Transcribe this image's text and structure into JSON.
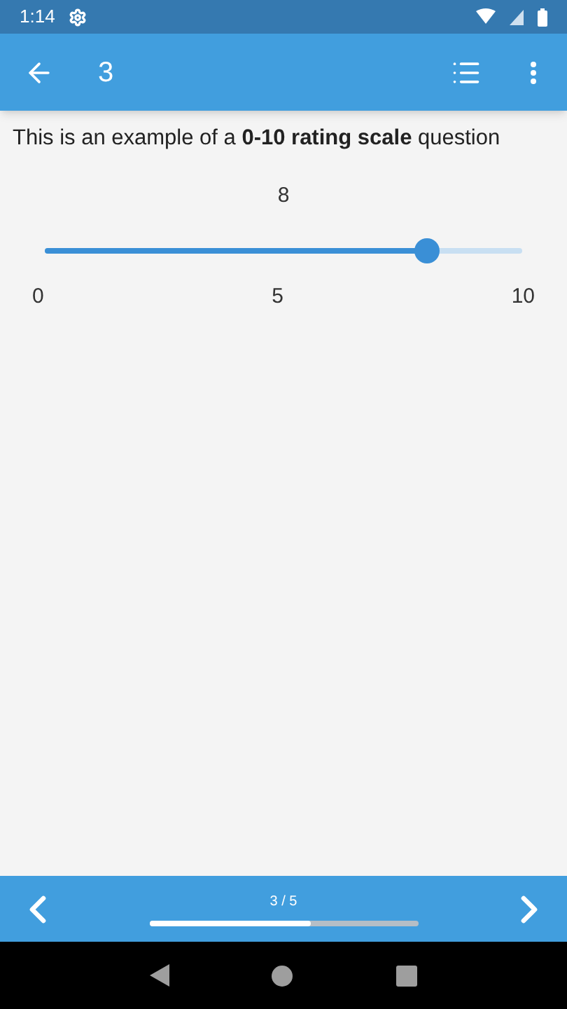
{
  "status_bar": {
    "time": "1:14"
  },
  "app_bar": {
    "title": "3"
  },
  "question": {
    "text": "This is an example of a **0-10 rating scale** question",
    "value": "8",
    "slider": {
      "level": 0.8
    },
    "labels": [
      "0",
      "5",
      "10"
    ]
  },
  "footer": {
    "counter": "3 / 5",
    "progress": {
      "level": 0.6
    }
  }
}
